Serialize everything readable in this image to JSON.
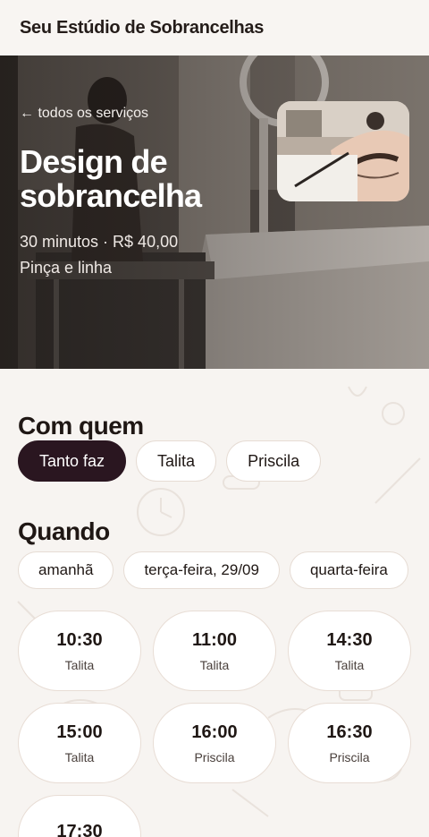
{
  "app": {
    "brand": "Seu Estúdio de Sobrancelhas"
  },
  "hero": {
    "back_label": "← todos os serviços",
    "service_title": "Design de sobrancelha",
    "meta": "30 minutos · R$ 40,00",
    "technique": "Pinça e linha"
  },
  "with_whom": {
    "title": "Com quem",
    "options": [
      "Tanto faz",
      "Talita",
      "Priscila"
    ],
    "selected": "Tanto faz"
  },
  "when": {
    "title": "Quando",
    "days": [
      "amanhã",
      "terça-feira, 29/09",
      "quarta-feira"
    ],
    "slots": [
      {
        "time": "10:30",
        "pro": "Talita"
      },
      {
        "time": "11:00",
        "pro": "Talita"
      },
      {
        "time": "14:30",
        "pro": "Talita"
      },
      {
        "time": "15:00",
        "pro": "Talita"
      },
      {
        "time": "16:00",
        "pro": "Priscila"
      },
      {
        "time": "16:30",
        "pro": "Priscila"
      },
      {
        "time": "17:30",
        "pro": ""
      }
    ]
  },
  "colors": {
    "accent": "#2a1620",
    "background": "#f7f4f1"
  }
}
